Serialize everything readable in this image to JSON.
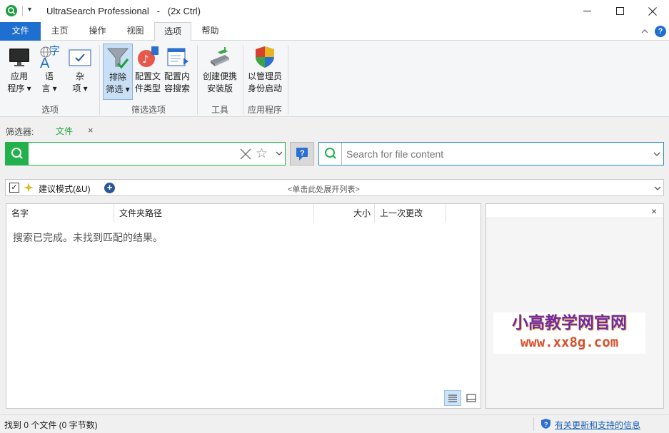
{
  "titlebar": {
    "title": "UltraSearch Professional   -   (2x Ctrl)",
    "quick_access": "▾",
    "minimize": "—",
    "maximize": "☐",
    "close": "✕"
  },
  "menu": {
    "tabs": [
      "文件",
      "主页",
      "操作",
      "视图",
      "选项",
      "帮助"
    ],
    "active": "选项",
    "collapse": "^",
    "help": "?"
  },
  "ribbon": {
    "groups": [
      {
        "label": "选项",
        "buttons": [
          {
            "line1": "应用",
            "line2": "程序 ▾"
          },
          {
            "line1": "语",
            "line2": "言 ▾"
          },
          {
            "line1": "杂",
            "line2": "项 ▾"
          }
        ]
      },
      {
        "label": "筛选选项",
        "buttons": [
          {
            "line1": "排除",
            "line2": "筛选 ▾"
          },
          {
            "line1": "配置文",
            "line2": "件类型"
          },
          {
            "line1": "配置内",
            "line2": "容搜索"
          }
        ]
      },
      {
        "label": "工具",
        "buttons": [
          {
            "line1": "创建便携",
            "line2": "安装版"
          }
        ]
      },
      {
        "label": "应用程序",
        "buttons": [
          {
            "line1": "以管理员",
            "line2": "身份启动"
          }
        ]
      }
    ],
    "lang_icon_char": "字"
  },
  "filter": {
    "label": "筛选器:",
    "tag": "文件",
    "tag_close": "×"
  },
  "search": {
    "placeholder": "",
    "content_placeholder": "Search for file content",
    "clear": "✕",
    "star": "☆",
    "dropdown": "⌄",
    "query_btn": "?"
  },
  "suggestion": {
    "label": "建议模式(&U)",
    "expand_text": "<单击此处展开列表>",
    "checked": "✓",
    "add": "+",
    "dropdown": "⌄"
  },
  "results": {
    "columns": [
      "名字",
      "文件夹路径",
      "大小",
      "上一次更改"
    ],
    "message": "搜索已完成。未找到匹配的结果。"
  },
  "preview": {
    "close": "×",
    "watermark_line1": "小高教学网官网",
    "watermark_line2": "www.xx8g.com"
  },
  "status": {
    "left": "找到 0 个文件 (0 字节数)",
    "right": "有关更新和支持的信息"
  },
  "colors": {
    "accent_blue": "#1f6fd1",
    "search_green": "#22b14c",
    "link_blue": "#1a5fb4"
  }
}
